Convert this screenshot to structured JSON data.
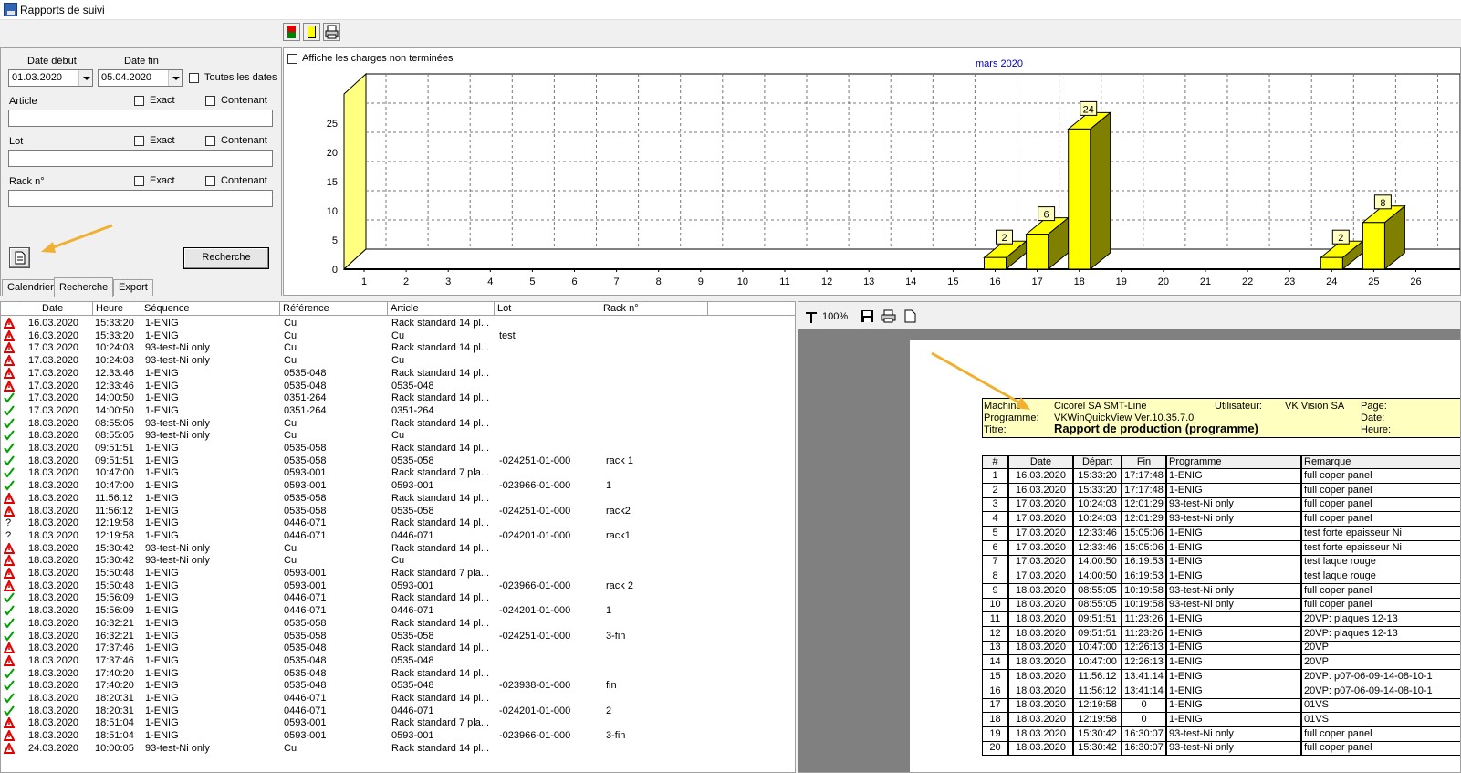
{
  "window": {
    "title": "Rapports de suivi"
  },
  "search": {
    "date_start_label": "Date début",
    "date_end_label": "Date fin",
    "date_start": "01.03.2020",
    "date_end": "05.04.2020",
    "all_dates_label": "Toutes les dates",
    "article_label": "Article",
    "lot_label": "Lot",
    "rack_label": "Rack n°",
    "exact_label": "Exact",
    "contains_label": "Contenant",
    "search_button": "Recherche"
  },
  "tabs": [
    "Calendrier",
    "Recherche",
    "Export"
  ],
  "chart_data": {
    "type": "bar",
    "title": "mars 2020",
    "show_unfinished_label": "Affiche les charges non terminées",
    "categories": [
      "1",
      "2",
      "3",
      "4",
      "5",
      "6",
      "7",
      "8",
      "9",
      "10",
      "11",
      "12",
      "13",
      "14",
      "15",
      "16",
      "17",
      "18",
      "19",
      "20",
      "21",
      "22",
      "23",
      "24",
      "25",
      "26"
    ],
    "values": [
      0,
      0,
      0,
      0,
      0,
      0,
      0,
      0,
      0,
      0,
      0,
      0,
      0,
      0,
      0,
      2,
      6,
      24,
      0,
      0,
      0,
      0,
      0,
      2,
      8,
      0
    ],
    "ylim": [
      0,
      30
    ],
    "yticks": [
      0,
      5,
      10,
      15,
      20,
      25
    ],
    "grid": true,
    "colors": {
      "bar_front": "#ffff00",
      "bar_side": "#808000",
      "axis_wall": "#ffff80"
    }
  },
  "grid": {
    "columns": [
      "Date",
      "Heure",
      "Séquence",
      "Référence",
      "Article",
      "Lot",
      "Rack n°"
    ],
    "rows": [
      [
        "warn",
        "16.03.2020",
        "15:33:20",
        "1-ENIG",
        "Cu",
        "Rack standard 14 pl...",
        "",
        ""
      ],
      [
        "warn",
        "16.03.2020",
        "15:33:20",
        "1-ENIG",
        "Cu",
        "Cu",
        "test",
        ""
      ],
      [
        "warn",
        "17.03.2020",
        "10:24:03",
        "93-test-Ni only",
        "Cu",
        "Rack standard 14 pl...",
        "",
        ""
      ],
      [
        "warn",
        "17.03.2020",
        "10:24:03",
        "93-test-Ni only",
        "Cu",
        "Cu",
        "",
        ""
      ],
      [
        "warn",
        "17.03.2020",
        "12:33:46",
        "1-ENIG",
        "0535-048",
        "Rack standard 14 pl...",
        "",
        ""
      ],
      [
        "warn",
        "17.03.2020",
        "12:33:46",
        "1-ENIG",
        "0535-048",
        "0535-048",
        "",
        ""
      ],
      [
        "ok",
        "17.03.2020",
        "14:00:50",
        "1-ENIG",
        "0351-264",
        "Rack standard 14 pl...",
        "",
        ""
      ],
      [
        "ok",
        "17.03.2020",
        "14:00:50",
        "1-ENIG",
        "0351-264",
        "0351-264",
        "",
        ""
      ],
      [
        "ok",
        "18.03.2020",
        "08:55:05",
        "93-test-Ni only",
        "Cu",
        "Rack standard 14 pl...",
        "",
        ""
      ],
      [
        "ok",
        "18.03.2020",
        "08:55:05",
        "93-test-Ni only",
        "Cu",
        "Cu",
        "",
        ""
      ],
      [
        "ok",
        "18.03.2020",
        "09:51:51",
        "1-ENIG",
        "0535-058",
        "Rack standard 14 pl...",
        "",
        ""
      ],
      [
        "ok",
        "18.03.2020",
        "09:51:51",
        "1-ENIG",
        "0535-058",
        "0535-058",
        "-024251-01-000",
        "rack 1"
      ],
      [
        "ok",
        "18.03.2020",
        "10:47:00",
        "1-ENIG",
        "0593-001",
        "Rack standard 7 pla...",
        "",
        ""
      ],
      [
        "ok",
        "18.03.2020",
        "10:47:00",
        "1-ENIG",
        "0593-001",
        "0593-001",
        "-023966-01-000",
        "1"
      ],
      [
        "warn",
        "18.03.2020",
        "11:56:12",
        "1-ENIG",
        "0535-058",
        "Rack standard 14 pl...",
        "",
        ""
      ],
      [
        "warn",
        "18.03.2020",
        "11:56:12",
        "1-ENIG",
        "0535-058",
        "0535-058",
        "-024251-01-000",
        "rack2"
      ],
      [
        "q",
        "18.03.2020",
        "12:19:58",
        "1-ENIG",
        "0446-071",
        "Rack standard 14 pl...",
        "",
        ""
      ],
      [
        "q",
        "18.03.2020",
        "12:19:58",
        "1-ENIG",
        "0446-071",
        "0446-071",
        "-024201-01-000",
        "rack1"
      ],
      [
        "warn",
        "18.03.2020",
        "15:30:42",
        "93-test-Ni only",
        "Cu",
        "Rack standard 14 pl...",
        "",
        ""
      ],
      [
        "warn",
        "18.03.2020",
        "15:30:42",
        "93-test-Ni only",
        "Cu",
        "Cu",
        "",
        ""
      ],
      [
        "warn",
        "18.03.2020",
        "15:50:48",
        "1-ENIG",
        "0593-001",
        "Rack standard 7 pla...",
        "",
        ""
      ],
      [
        "warn",
        "18.03.2020",
        "15:50:48",
        "1-ENIG",
        "0593-001",
        "0593-001",
        "-023966-01-000",
        "rack 2"
      ],
      [
        "ok",
        "18.03.2020",
        "15:56:09",
        "1-ENIG",
        "0446-071",
        "Rack standard 14 pl...",
        "",
        ""
      ],
      [
        "ok",
        "18.03.2020",
        "15:56:09",
        "1-ENIG",
        "0446-071",
        "0446-071",
        "-024201-01-000",
        "1"
      ],
      [
        "ok",
        "18.03.2020",
        "16:32:21",
        "1-ENIG",
        "0535-058",
        "Rack standard 14 pl...",
        "",
        ""
      ],
      [
        "ok",
        "18.03.2020",
        "16:32:21",
        "1-ENIG",
        "0535-058",
        "0535-058",
        "-024251-01-000",
        "3-fin"
      ],
      [
        "warn",
        "18.03.2020",
        "17:37:46",
        "1-ENIG",
        "0535-048",
        "Rack standard 14 pl...",
        "",
        ""
      ],
      [
        "warn",
        "18.03.2020",
        "17:37:46",
        "1-ENIG",
        "0535-048",
        "0535-048",
        "",
        ""
      ],
      [
        "ok",
        "18.03.2020",
        "17:40:20",
        "1-ENIG",
        "0535-048",
        "Rack standard 14 pl...",
        "",
        ""
      ],
      [
        "ok",
        "18.03.2020",
        "17:40:20",
        "1-ENIG",
        "0535-048",
        "0535-048",
        "-023938-01-000",
        "fin"
      ],
      [
        "ok",
        "18.03.2020",
        "18:20:31",
        "1-ENIG",
        "0446-071",
        "Rack standard 14 pl...",
        "",
        ""
      ],
      [
        "ok",
        "18.03.2020",
        "18:20:31",
        "1-ENIG",
        "0446-071",
        "0446-071",
        "-024201-01-000",
        "2"
      ],
      [
        "warn",
        "18.03.2020",
        "18:51:04",
        "1-ENIG",
        "0593-001",
        "Rack standard 7 pla...",
        "",
        ""
      ],
      [
        "warn",
        "18.03.2020",
        "18:51:04",
        "1-ENIG",
        "0593-001",
        "0593-001",
        "-023966-01-000",
        "3-fin"
      ],
      [
        "warn",
        "24.03.2020",
        "10:00:05",
        "93-test-Ni only",
        "Cu",
        "Rack standard 14 pl...",
        "",
        ""
      ]
    ]
  },
  "preview": {
    "zoom": "100%",
    "machine_label": "Machine:",
    "machine": "Cicorel SA SMT-Line",
    "user_label": "Utilisateur:",
    "user": "VK Vision SA",
    "page_label": "Page:",
    "program_label": "Programme:",
    "program": "VKWinQuickView Ver.10.35.7.0",
    "date_label": "Date:",
    "title_label": "Titre:",
    "title": "Rapport de production (programme)",
    "time_label": "Heure:",
    "columns": [
      "#",
      "Date",
      "Départ",
      "Fin",
      "Programme",
      "Remarque"
    ],
    "rows": [
      [
        "1",
        "16.03.2020",
        "15:33:20",
        "17:17:48",
        "1-ENIG",
        "full coper panel"
      ],
      [
        "2",
        "16.03.2020",
        "15:33:20",
        "17:17:48",
        "1-ENIG",
        "full coper panel"
      ],
      [
        "3",
        "17.03.2020",
        "10:24:03",
        "12:01:29",
        "93-test-Ni only",
        "full coper panel"
      ],
      [
        "4",
        "17.03.2020",
        "10:24:03",
        "12:01:29",
        "93-test-Ni only",
        "full coper panel"
      ],
      [
        "5",
        "17.03.2020",
        "12:33:46",
        "15:05:06",
        "1-ENIG",
        "test forte epaisseur Ni"
      ],
      [
        "6",
        "17.03.2020",
        "12:33:46",
        "15:05:06",
        "1-ENIG",
        "test forte epaisseur Ni"
      ],
      [
        "7",
        "17.03.2020",
        "14:00:50",
        "16:19:53",
        "1-ENIG",
        "test laque rouge"
      ],
      [
        "8",
        "17.03.2020",
        "14:00:50",
        "16:19:53",
        "1-ENIG",
        "test laque rouge"
      ],
      [
        "9",
        "18.03.2020",
        "08:55:05",
        "10:19:58",
        "93-test-Ni only",
        "full coper panel"
      ],
      [
        "10",
        "18.03.2020",
        "08:55:05",
        "10:19:58",
        "93-test-Ni only",
        "full coper panel"
      ],
      [
        "11",
        "18.03.2020",
        "09:51:51",
        "11:23:26",
        "1-ENIG",
        "20VP: plaques 12-13"
      ],
      [
        "12",
        "18.03.2020",
        "09:51:51",
        "11:23:26",
        "1-ENIG",
        "20VP: plaques 12-13"
      ],
      [
        "13",
        "18.03.2020",
        "10:47:00",
        "12:26:13",
        "1-ENIG",
        "20VP"
      ],
      [
        "14",
        "18.03.2020",
        "10:47:00",
        "12:26:13",
        "1-ENIG",
        "20VP"
      ],
      [
        "15",
        "18.03.2020",
        "11:56:12",
        "13:41:14",
        "1-ENIG",
        "20VP: p07-06-09-14-08-10-1"
      ],
      [
        "16",
        "18.03.2020",
        "11:56:12",
        "13:41:14",
        "1-ENIG",
        "20VP: p07-06-09-14-08-10-1"
      ],
      [
        "17",
        "18.03.2020",
        "12:19:58",
        "0",
        "1-ENIG",
        "01VS"
      ],
      [
        "18",
        "18.03.2020",
        "12:19:58",
        "0",
        "1-ENIG",
        "01VS"
      ],
      [
        "19",
        "18.03.2020",
        "15:30:42",
        "16:30:07",
        "93-test-Ni only",
        "full coper panel"
      ],
      [
        "20",
        "18.03.2020",
        "15:30:42",
        "16:30:07",
        "93-test-Ni only",
        "full coper panel"
      ]
    ]
  }
}
